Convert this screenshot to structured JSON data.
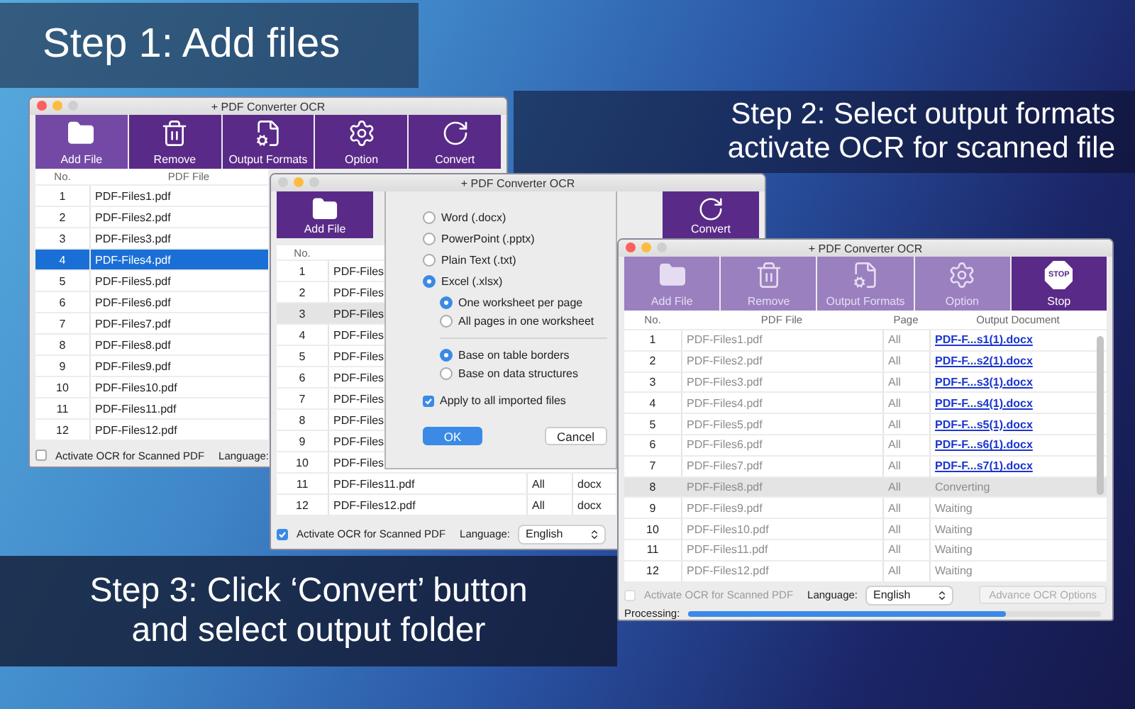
{
  "captions": [
    {
      "lines": [
        "Step 1: Add files"
      ]
    },
    {
      "lines": [
        "Step 2: Select output formats",
        "activate OCR for scanned file"
      ]
    },
    {
      "lines": [
        "Step 3: Click ‘Convert’ button",
        "and select output folder"
      ]
    }
  ],
  "windows": [
    {
      "title": "+ PDF Converter OCR",
      "active": true,
      "busy": false,
      "toolbar": [
        {
          "label": "Add File",
          "kind": "folder",
          "selected": true,
          "disabled": false
        },
        {
          "label": "Remove",
          "kind": "trash",
          "selected": false,
          "disabled": false
        },
        {
          "label": "Output Formats",
          "kind": "formats",
          "selected": false,
          "disabled": false
        },
        {
          "label": "Option",
          "kind": "gear",
          "selected": false,
          "disabled": false
        },
        {
          "label": "Convert",
          "kind": "convert",
          "selected": false,
          "disabled": false
        }
      ],
      "columns": [
        "No.",
        "PDF File"
      ],
      "rows": [
        {
          "cells": [
            "1",
            "PDF-Files1.pdf"
          ],
          "selected": false
        },
        {
          "cells": [
            "2",
            "PDF-Files2.pdf"
          ],
          "selected": false
        },
        {
          "cells": [
            "3",
            "PDF-Files3.pdf"
          ],
          "selected": false
        },
        {
          "cells": [
            "4",
            "PDF-Files4.pdf"
          ],
          "selected": true
        },
        {
          "cells": [
            "5",
            "PDF-Files5.pdf"
          ],
          "selected": false
        },
        {
          "cells": [
            "6",
            "PDF-Files6.pdf"
          ],
          "selected": false
        },
        {
          "cells": [
            "7",
            "PDF-Files7.pdf"
          ],
          "selected": false
        },
        {
          "cells": [
            "8",
            "PDF-Files8.pdf"
          ],
          "selected": false
        },
        {
          "cells": [
            "9",
            "PDF-Files9.pdf"
          ],
          "selected": false
        },
        {
          "cells": [
            "10",
            "PDF-Files10.pdf"
          ],
          "selected": false
        },
        {
          "cells": [
            "11",
            "PDF-Files11.pdf"
          ],
          "selected": false
        },
        {
          "cells": [
            "12",
            "PDF-Files12.pdf"
          ],
          "selected": false
        }
      ],
      "ocr": {
        "label": "Activate OCR for Scanned PDF",
        "checked": false
      },
      "language": {
        "label": "Language:"
      }
    },
    {
      "title": "+ PDF Converter OCR",
      "active": false,
      "busy": false,
      "toolbar": [
        {
          "label": "Add File",
          "kind": "folder",
          "selected": false,
          "disabled": false
        },
        {
          "label": "Convert",
          "kind": "convert",
          "selected": false,
          "disabled": false
        }
      ],
      "columns": [
        "No."
      ],
      "rows": [
        {
          "cells": [
            "1",
            "PDF-Files"
          ],
          "selected": false
        },
        {
          "cells": [
            "2",
            "PDF-Files"
          ],
          "selected": false
        },
        {
          "cells": [
            "3",
            "PDF-Files"
          ],
          "selected": true
        },
        {
          "cells": [
            "4",
            "PDF-Files"
          ],
          "selected": false
        },
        {
          "cells": [
            "5",
            "PDF-Files"
          ],
          "selected": false
        },
        {
          "cells": [
            "6",
            "PDF-Files"
          ],
          "selected": false
        },
        {
          "cells": [
            "7",
            "PDF-Files"
          ],
          "selected": false
        },
        {
          "cells": [
            "8",
            "PDF-Files"
          ],
          "selected": false
        },
        {
          "cells": [
            "9",
            "PDF-Files"
          ],
          "selected": false
        },
        {
          "cells": [
            "10",
            "PDF-Files"
          ],
          "selected": false
        },
        {
          "cells": [
            "11",
            "PDF-Files11.pdf",
            "All",
            "docx"
          ],
          "selected": false
        },
        {
          "cells": [
            "12",
            "PDF-Files12.pdf",
            "All",
            "docx"
          ],
          "selected": false
        }
      ],
      "ocr": {
        "label": "Activate OCR for Scanned PDF",
        "checked": true
      },
      "language": {
        "label": "Language:",
        "value": "English"
      },
      "dialog": {
        "formats": [
          {
            "label": "Word (.docx)",
            "selected": false
          },
          {
            "label": "PowerPoint (.pptx)",
            "selected": false
          },
          {
            "label": "Plain Text (.txt)",
            "selected": false
          },
          {
            "label": "Excel (.xlsx)",
            "selected": true,
            "groups": [
              [
                {
                  "label": "One worksheet per page",
                  "selected": true
                },
                {
                  "label": "All pages in one worksheet",
                  "selected": false
                }
              ],
              [
                {
                  "label": "Base on table borders",
                  "selected": true
                },
                {
                  "label": "Base on data structures",
                  "selected": false
                }
              ]
            ]
          }
        ],
        "apply": {
          "label": "Apply to all imported files",
          "checked": true
        },
        "buttons": [
          {
            "label": "OK",
            "kind": "primary"
          },
          {
            "label": "Cancel",
            "kind": "default"
          }
        ]
      }
    },
    {
      "title": "+ PDF Converter OCR",
      "active": true,
      "busy": true,
      "toolbar": [
        {
          "label": "Add File",
          "kind": "folder",
          "selected": false,
          "disabled": true
        },
        {
          "label": "Remove",
          "kind": "trash",
          "selected": false,
          "disabled": true
        },
        {
          "label": "Output Formats",
          "kind": "formats",
          "selected": false,
          "disabled": true
        },
        {
          "label": "Option",
          "kind": "gear",
          "selected": false,
          "disabled": true
        },
        {
          "label": "Stop",
          "kind": "stop",
          "icon_text": "STOP",
          "selected": false,
          "disabled": false
        }
      ],
      "columns": [
        "No.",
        "PDF File",
        "Page",
        "Output Document"
      ],
      "rows": [
        {
          "cells": [
            "1",
            "PDF-Files1.pdf",
            "All",
            "PDF-F...s1(1).docx"
          ],
          "kind": "link",
          "selected": false
        },
        {
          "cells": [
            "2",
            "PDF-Files2.pdf",
            "All",
            "PDF-F...s2(1).docx"
          ],
          "kind": "link",
          "selected": false
        },
        {
          "cells": [
            "3",
            "PDF-Files3.pdf",
            "All",
            "PDF-F...s3(1).docx"
          ],
          "kind": "link",
          "selected": false
        },
        {
          "cells": [
            "4",
            "PDF-Files4.pdf",
            "All",
            "PDF-F...s4(1).docx"
          ],
          "kind": "link",
          "selected": false
        },
        {
          "cells": [
            "5",
            "PDF-Files5.pdf",
            "All",
            "PDF-F...s5(1).docx"
          ],
          "kind": "link",
          "selected": false
        },
        {
          "cells": [
            "6",
            "PDF-Files6.pdf",
            "All",
            "PDF-F...s6(1).docx"
          ],
          "kind": "link",
          "selected": false
        },
        {
          "cells": [
            "7",
            "PDF-Files7.pdf",
            "All",
            "PDF-F...s7(1).docx"
          ],
          "kind": "link",
          "selected": false
        },
        {
          "cells": [
            "8",
            "PDF-Files8.pdf",
            "All",
            "Converting"
          ],
          "kind": "status",
          "selected": true
        },
        {
          "cells": [
            "9",
            "PDF-Files9.pdf",
            "All",
            "Waiting"
          ],
          "kind": "status",
          "selected": false
        },
        {
          "cells": [
            "10",
            "PDF-Files10.pdf",
            "All",
            "Waiting"
          ],
          "kind": "status",
          "selected": false
        },
        {
          "cells": [
            "11",
            "PDF-Files11.pdf",
            "All",
            "Waiting"
          ],
          "kind": "status",
          "selected": false
        },
        {
          "cells": [
            "12",
            "PDF-Files12.pdf",
            "All",
            "Waiting"
          ],
          "kind": "status",
          "selected": false
        }
      ],
      "ocr": {
        "label": "Activate OCR for Scanned PDF",
        "checked": false
      },
      "language": {
        "label": "Language:",
        "value": "English"
      },
      "advanced": {
        "label": "Advance OCR Options"
      },
      "progress": {
        "label": "Processing:",
        "level": 0.77
      }
    }
  ]
}
